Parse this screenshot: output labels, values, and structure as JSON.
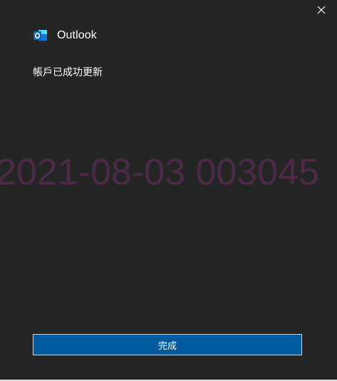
{
  "dialog": {
    "app_name": "Outlook",
    "message": "帳戶已成功更新",
    "done_label": "完成",
    "watermark": "2021-08-03  003045"
  },
  "icons": {
    "close": "close-icon",
    "logo": "outlook-logo-icon"
  },
  "colors": {
    "background": "#252525",
    "button": "#005a9e",
    "button_border": "#c8d6e4",
    "watermark": "#4a2a46",
    "logo_blue": "#0f78d4"
  }
}
